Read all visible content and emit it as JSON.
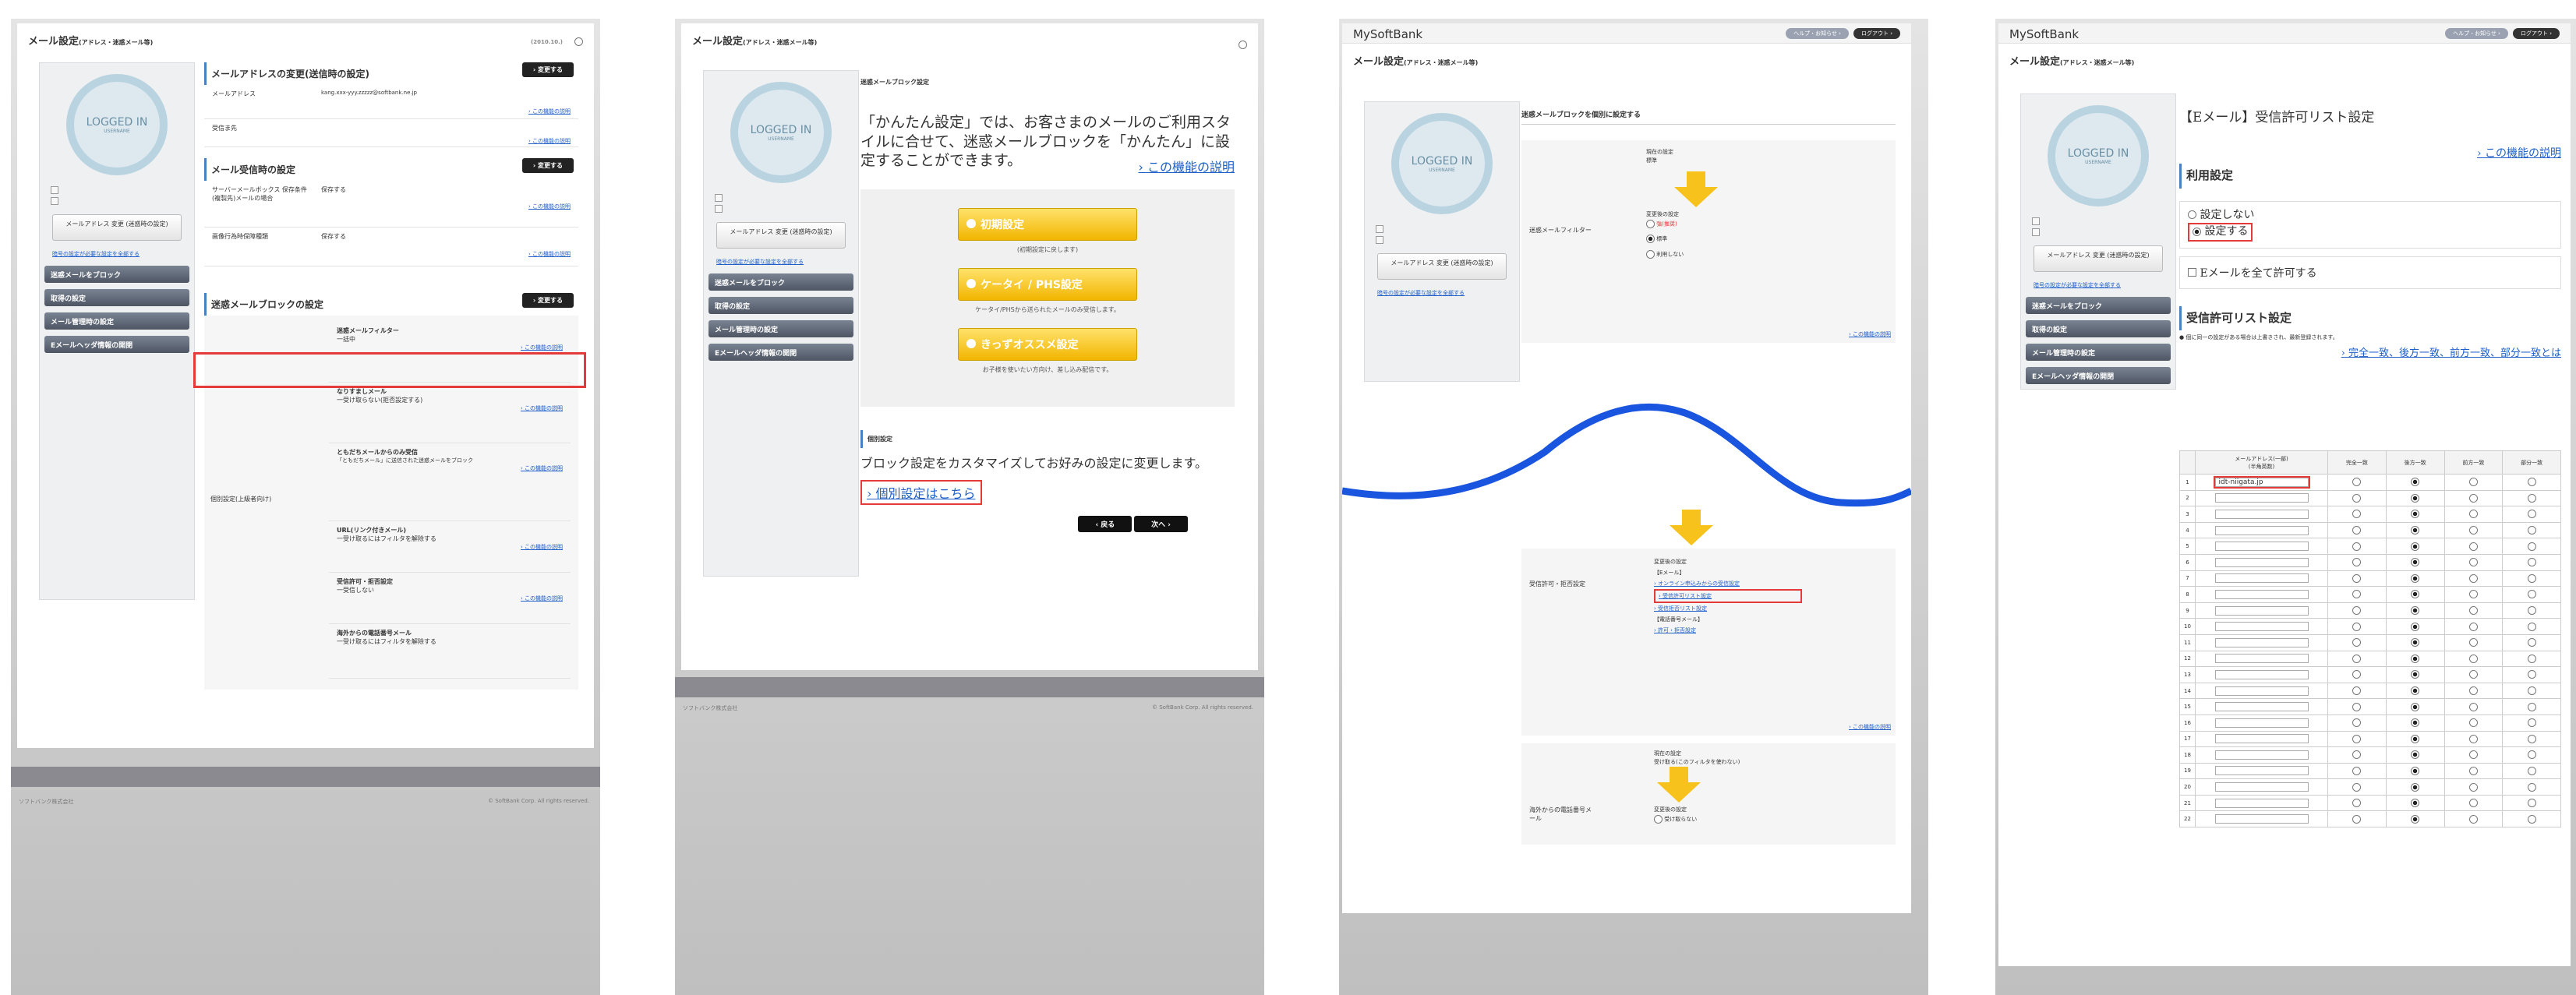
{
  "title_mail": "メール設定",
  "title_mail_sub": "(アドレス・迷惑メール等)",
  "brand": "MySoftBank",
  "pill_help": "ヘルプ・お知らせ ›",
  "pill_logout": "ログアウト ›",
  "date_stub": "(2010.10.)",
  "logo_main": "LOGGED IN",
  "logo_sub": "USERNAME",
  "side_btn": "メールアドレス 変更\n(迷惑時の設定)",
  "side_link": "暗号の設定が必要な設定を全部する",
  "nav": [
    "迷惑メールをブロック",
    "取得の設定",
    "メール管理時の設定",
    "Eメールヘッダ情報の開閉"
  ],
  "p1": {
    "sec1": "メールアドレスの変更(送信時の設定)",
    "r1_label": "メールアドレス",
    "r1_value": "kang.xxx-yyy.zzzzz@softbank.ne.jp",
    "r2_label": "受信ま先",
    "sec2": "メール受信時の設定",
    "r3_label": "サーバーメールボックス 保存条件 (複製先)メールの場合",
    "r4_label": "画像行為時保障種類",
    "r3_value": "保存する",
    "r4_value": "保存する",
    "sec3": "迷惑メールブロックの設定",
    "change": "› 変更する",
    "help": "› この機能の説明",
    "bl_label": "個別設定(上級者向け)",
    "items": [
      "迷惑メールフィルター",
      "なりすましメール",
      "ともだちメールからのみ受信",
      "URL(リンク付きメール)",
      "受信許可・拒否設定",
      "海外からの電話番号メール"
    ],
    "item_notes": [
      "一括中",
      "一受け取らない(拒否設定する)",
      "「ともだちメール」に送信された迷惑メールをブロック",
      "一受け取るにはフィルタを解除する",
      "一受信しない",
      "一受け取るにはフィルタを解除する"
    ]
  },
  "p2": {
    "sec": "迷惑メールブロック設定",
    "lead": "「かんたん設定」では、お客さまのメールのご利用スタイルに合せて、迷惑メールブロックを「かんたん」に設定することができます。",
    "helplink": "› この機能の説明",
    "btns": [
      "初期設定",
      "ケータイ / PHS設定",
      "きっずオススメ設定"
    ],
    "caps": [
      "(初期設定に戻します)",
      "ケータイ/PHSから送られたメールのみ受信します。",
      "お子様を使いたい方向け、差し込み配信です。"
    ],
    "sec2": "個別設定",
    "body2": "ブロック設定をカスタマイズしてお好みの設定に変更します。",
    "link2": "› 個別設定はこちら",
    "back": "‹ 戻る",
    "next": "次へ ›",
    "footer": "ソフトバンク株式会社",
    "copy": "© SoftBank Corp. All rights reserved."
  },
  "p3": {
    "sec": "迷惑メールブロックを個別に設定する",
    "f1": "迷惑メールフィルター",
    "f1a": "現在の設定",
    "f1b": "標準",
    "f1c": "変更後の設定",
    "f1d": "強(推奨)",
    "f1e": "標準",
    "f1f": "利用しない",
    "f2": "受信許可・拒否設定",
    "f2a": "変更後の設定",
    "f2b": "【Eメール】",
    "links": [
      "› オンライン申込みからの受信設定",
      "› 受信許可リスト設定",
      "› 受信拒否リスト設定"
    ],
    "f2c": "【電話番号メール】",
    "f2d": "› 許可・拒否設定",
    "f3": "海外からの電話番号メール",
    "f3a": "現在の設定",
    "f3b": "受け取る(このフィルタを使わない)",
    "f3c": "変更後の設定",
    "f3d": "受け取らない",
    "help": "› この機能の説明"
  },
  "p4": {
    "sec": "【Eメール】受信許可リスト設定",
    "help": "› この機能の説明",
    "use": "利用設定",
    "opt_off": "設定しない",
    "opt_on": "設定する",
    "allow_all": "Eメールを全て許可する",
    "list": "受信許可リスト設定",
    "note": "● 個に同一の設定がある場合は上書きされ、最新登録されます。",
    "match": "› 完全一致、後方一致、前方一致、部分一致とは",
    "col_addr": "メールアドレス(一部)\n(半角英数)",
    "cols": [
      "完全一致",
      "後方一致",
      "前方一致",
      "部分一致"
    ],
    "entry": "idt-niigata.jp",
    "rows": [
      "1",
      "2",
      "3",
      "4",
      "5",
      "6",
      "7",
      "8",
      "9",
      "10",
      "11",
      "12",
      "13",
      "14",
      "15",
      "16",
      "17",
      "18",
      "19",
      "20",
      "21",
      "22"
    ]
  }
}
